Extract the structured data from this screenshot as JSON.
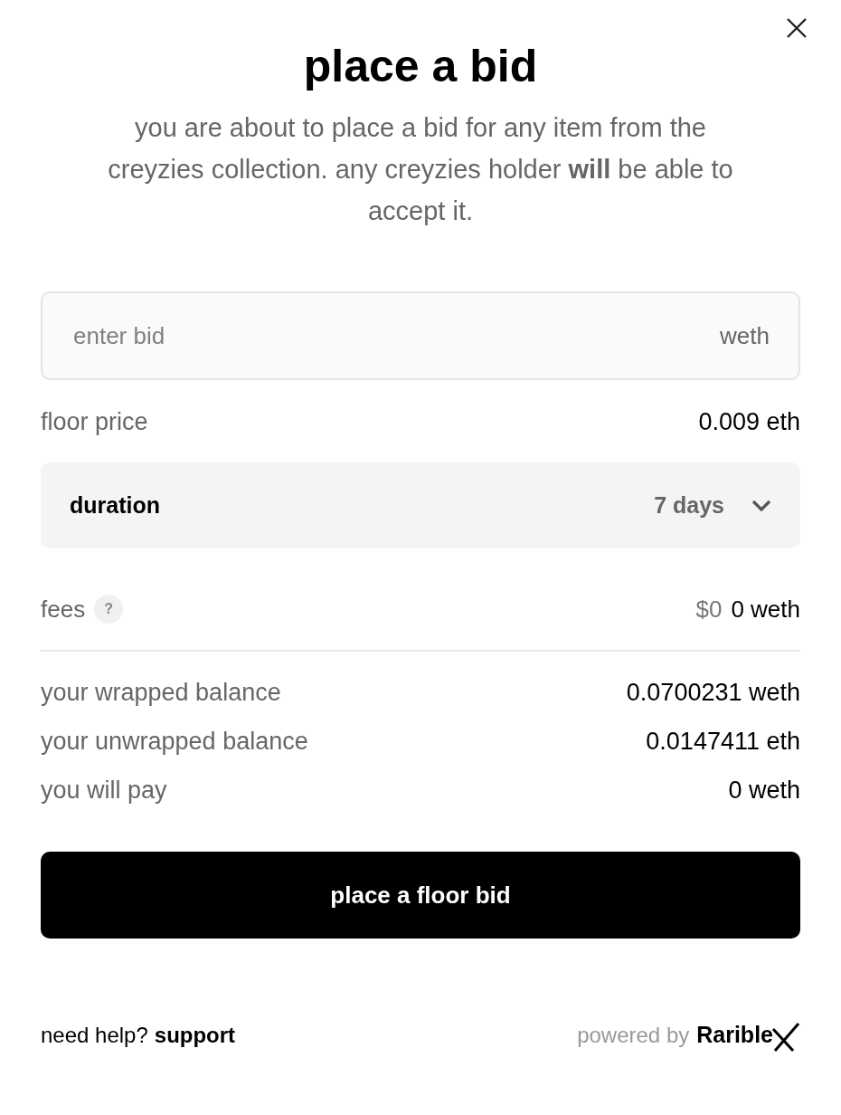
{
  "title": "place a bid",
  "description": "you are about to place a bid for any item from the creyzies collection. any creyzies holder **will** be able to accept it.",
  "bid_field": {
    "placeholder": "enter bid",
    "currency": "weth"
  },
  "floor_price": {
    "label": "floor price",
    "value": "0.009 eth"
  },
  "duration": {
    "label": "duration",
    "value": "7 days",
    "expanded": false
  },
  "fees": {
    "label": "fees",
    "help": "?",
    "usd": "$0",
    "value": "0 weth"
  },
  "summary": [
    {
      "label": "your wrapped balance",
      "value": "0.0700231 weth"
    },
    {
      "label": "your unwrapped balance",
      "value": "0.0147411 eth"
    },
    {
      "label": "you will pay",
      "value": "0 weth"
    }
  ],
  "submit_button": "place a floor bid",
  "footer": {
    "help": "need help?",
    "support_link": "support",
    "powered_by": "powered by",
    "brand": "Rarible"
  }
}
